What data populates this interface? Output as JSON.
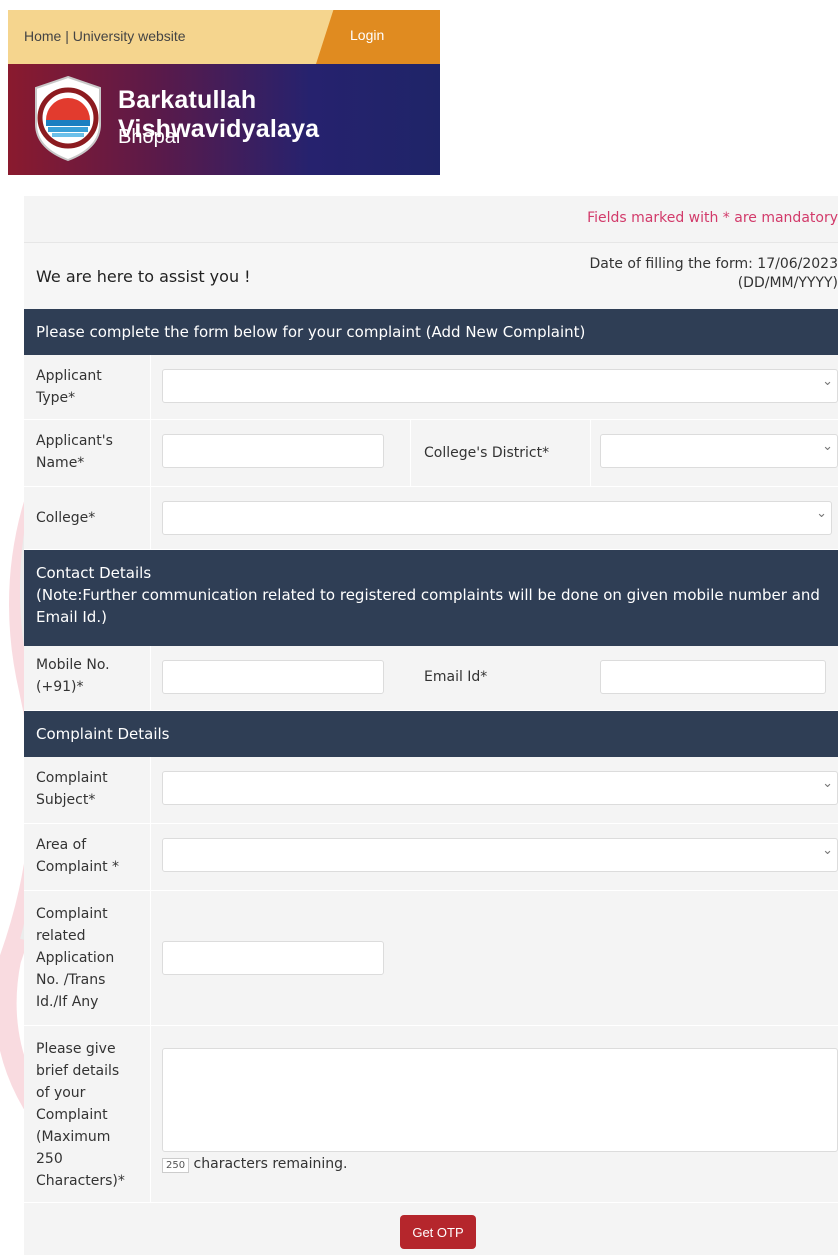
{
  "header": {
    "links": "Home | University website",
    "login": "Login",
    "brand_name": "Barkatullah Vishwavidyalaya",
    "brand_city": "Bhopal"
  },
  "form": {
    "mandatory_note": "Fields marked with * are mandatory",
    "assist": "We are here to assist you !",
    "date_line": "Date of filling the form: 17/06/2023",
    "date_format": "(DD/MM/YYYY)",
    "section1": "Please complete the form below for your complaint (Add New Complaint)",
    "applicant_type": "Applicant Type*",
    "applicant_name": "Applicant's Name*",
    "college_district": "College's District*",
    "college": "College*",
    "contact_title": "Contact Details",
    "contact_note": "(Note:Further communication related to registered complaints will be done on given mobile number and Email Id.)",
    "mobile": "Mobile No. (+91)*",
    "email": "Email Id*",
    "complaint_title": "Complaint Details",
    "complaint_subject": "Complaint Subject*",
    "area": "Area of Complaint *",
    "app_no": "Complaint related Application No. /Trans Id./If Any",
    "details": "Please give brief details of your Complaint (Maximum 250 Characters)*",
    "char_count": "250",
    "char_text": "characters remaining.",
    "otp_button": "Get OTP"
  },
  "colors": {
    "header_bar": "#2f3e55",
    "accent_red": "#b5262c",
    "mandatory_pink": "#d23a6a"
  }
}
